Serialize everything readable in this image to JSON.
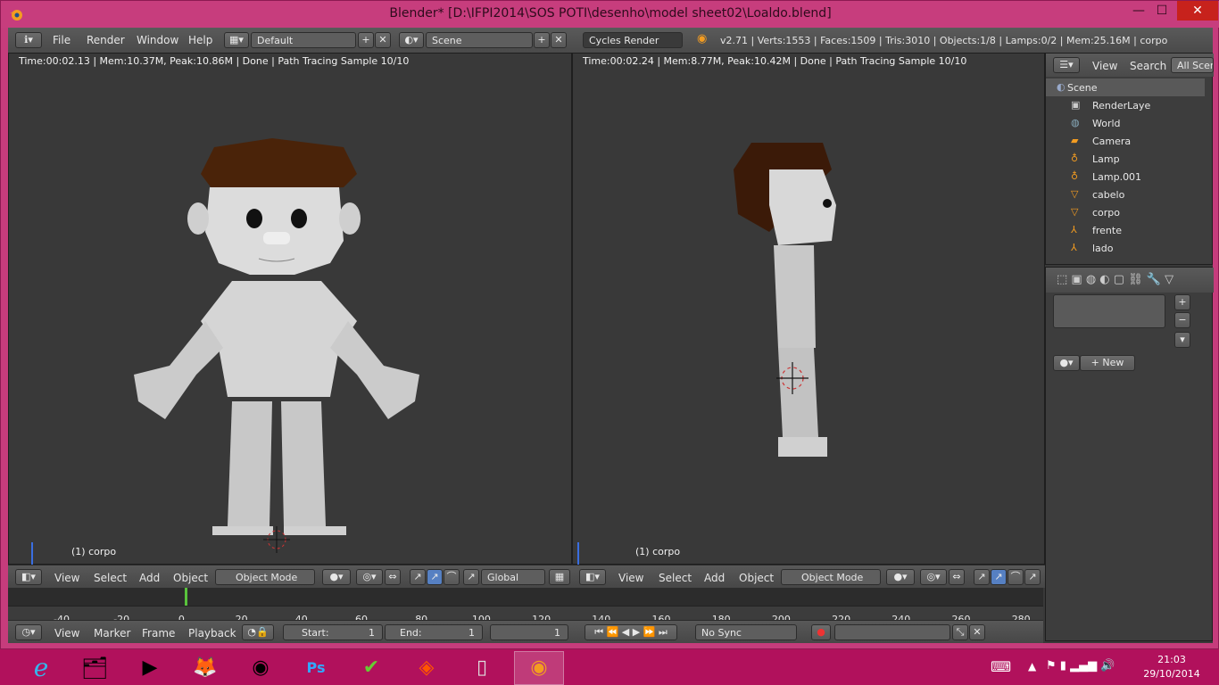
{
  "window": {
    "title": "Blender* [D:\\IFPI2014\\SOS POTI\\desenho\\model sheet02\\Loaldo.blend]",
    "min": "—",
    "max": "☐",
    "close": "✕"
  },
  "topbar": {
    "menus": [
      "File",
      "Render",
      "Window",
      "Help"
    ],
    "layout": "Default",
    "scene": "Scene",
    "engine": "Cycles Render",
    "stats": "v2.71 | Verts:1553 | Faces:1509 | Tris:3010 | Objects:1/8 | Lamps:0/2 | Mem:25.16M | corpo"
  },
  "viewport_left": {
    "info": "Time:00:02.13 | Mem:10.37M, Peak:10.86M | Done | Path Tracing Sample 10/10",
    "object": "(1) corpo",
    "menus": [
      "View",
      "Select",
      "Add",
      "Object"
    ],
    "mode": "Object Mode",
    "orientation": "Global"
  },
  "viewport_right": {
    "info": "Time:00:02.24 | Mem:8.77M, Peak:10.42M | Done | Path Tracing Sample 10/10",
    "object": "(1) corpo",
    "menus": [
      "View",
      "Select",
      "Add",
      "Object"
    ],
    "mode": "Object Mode"
  },
  "outliner": {
    "menus": [
      "View",
      "Search"
    ],
    "filter": "All Scen",
    "items": [
      "Scene",
      "RenderLaye",
      "World",
      "Camera",
      "Lamp",
      "Lamp.001",
      "cabelo",
      "corpo",
      "frente",
      "lado"
    ]
  },
  "properties": {
    "new_label": "New"
  },
  "timeline": {
    "ticks": [
      "-40",
      "-20",
      "0",
      "20",
      "40",
      "60",
      "80",
      "100",
      "120",
      "140",
      "160",
      "180",
      "200",
      "220",
      "240",
      "260",
      "280"
    ],
    "menus": [
      "View",
      "Marker",
      "Frame",
      "Playback"
    ],
    "start_label": "Start:",
    "start": "1",
    "end_label": "End:",
    "end": "1",
    "current": "1",
    "sync": "No Sync"
  },
  "taskbar": {
    "time": "21:03",
    "date": "29/10/2014"
  },
  "colors": {
    "accent": "#b1115c",
    "header": "#4f4f4f",
    "viewport": "#393939",
    "selected": "#5680c2"
  }
}
